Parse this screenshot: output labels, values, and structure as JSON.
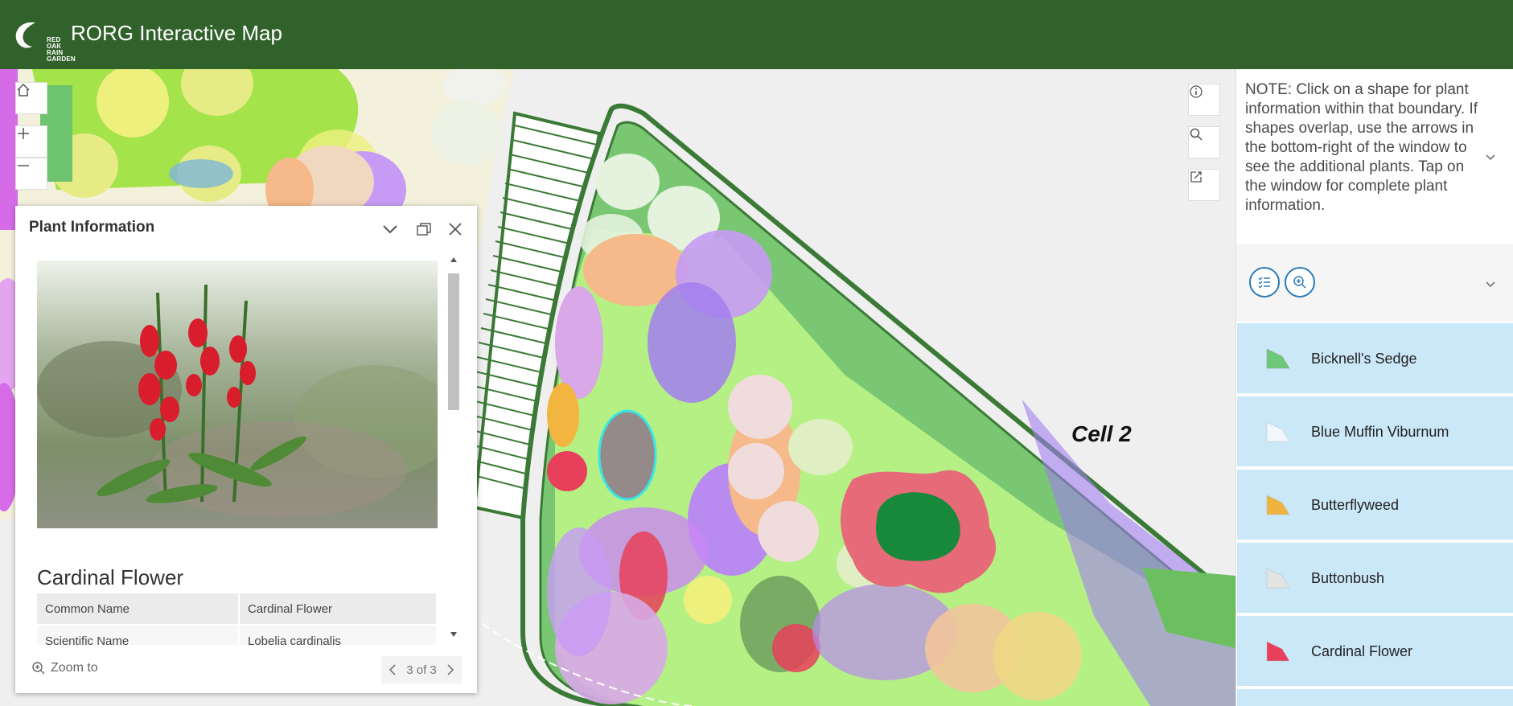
{
  "header": {
    "title": "RORG Interactive Map",
    "logo_text": [
      "RED",
      "OAK",
      "RAIN",
      "GARDEN"
    ],
    "bg_color": "#32622c"
  },
  "map": {
    "cell_label": "Cell 2",
    "controls": {
      "home": "home-icon",
      "zoom_in": "plus-icon",
      "zoom_out": "minus-icon",
      "info": "info-icon",
      "search": "search-icon",
      "share": "share-icon"
    }
  },
  "popup": {
    "title": "Plant Information",
    "feature_title": "Cardinal Flower",
    "attributes": [
      {
        "field": "Common Name",
        "value": "Cardinal Flower"
      },
      {
        "field": "Scientific Name",
        "value": "Lobelia cardinalis"
      }
    ],
    "zoom_to": "Zoom to",
    "pager": "3 of 3"
  },
  "panel": {
    "note": "NOTE: Click on a shape for plant information within that boundary. If shapes overlap, use the arrows in the bottom-right of the window to see the additional plants. Tap on the window for complete plant information.",
    "legend": [
      {
        "label": "Bicknell's Sedge",
        "color": "#6dc977"
      },
      {
        "label": "Blue Muffin Viburnum",
        "color": "#f2f7fb"
      },
      {
        "label": "Butterflyweed",
        "color": "#f0b43e"
      },
      {
        "label": "Buttonbush",
        "color": "#e3e3e3"
      },
      {
        "label": "Cardinal Flower",
        "color": "#e8405a"
      }
    ],
    "accent_color": "#2b7bb9"
  }
}
